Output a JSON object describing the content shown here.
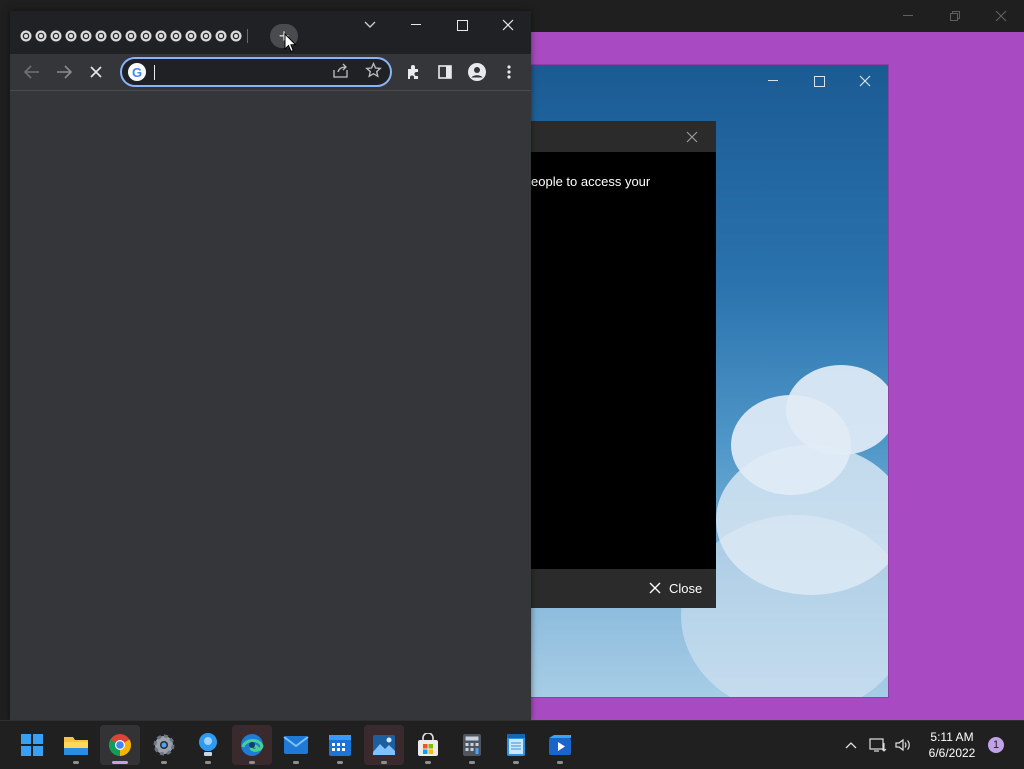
{
  "dialog": {
    "body_text": "eople to access your",
    "close_label": "Close"
  },
  "chrome": {
    "tab_count": 15,
    "new_tab_symbol": "+",
    "address_value": ""
  },
  "taskbar": {
    "apps": [
      {
        "name": "start-button",
        "icon": "windows-logo-icon"
      },
      {
        "name": "file-explorer",
        "icon": "folder-icon"
      },
      {
        "name": "google-chrome",
        "icon": "chrome-icon",
        "active": true
      },
      {
        "name": "settings",
        "icon": "gear-icon"
      },
      {
        "name": "tips",
        "icon": "lightbulb-icon"
      },
      {
        "name": "microsoft-edge",
        "icon": "edge-icon"
      },
      {
        "name": "mail",
        "icon": "mail-icon"
      },
      {
        "name": "calendar",
        "icon": "calendar-icon"
      },
      {
        "name": "photos",
        "icon": "photos-icon"
      },
      {
        "name": "microsoft-store",
        "icon": "store-icon"
      },
      {
        "name": "calculator",
        "icon": "calculator-icon"
      },
      {
        "name": "notepad",
        "icon": "notepad-icon"
      },
      {
        "name": "video-editor",
        "icon": "video-icon"
      }
    ],
    "time": "5:11 AM",
    "date": "6/6/2022",
    "notification_count": "1"
  },
  "colors": {
    "desktop_purple": "#a84bc3",
    "chrome_frame": "#202124",
    "chrome_toolbar": "#35363a",
    "omnibox_focus": "#8ab4f8",
    "taskbar": "#202020",
    "notification_badge": "#c1a2e9"
  }
}
